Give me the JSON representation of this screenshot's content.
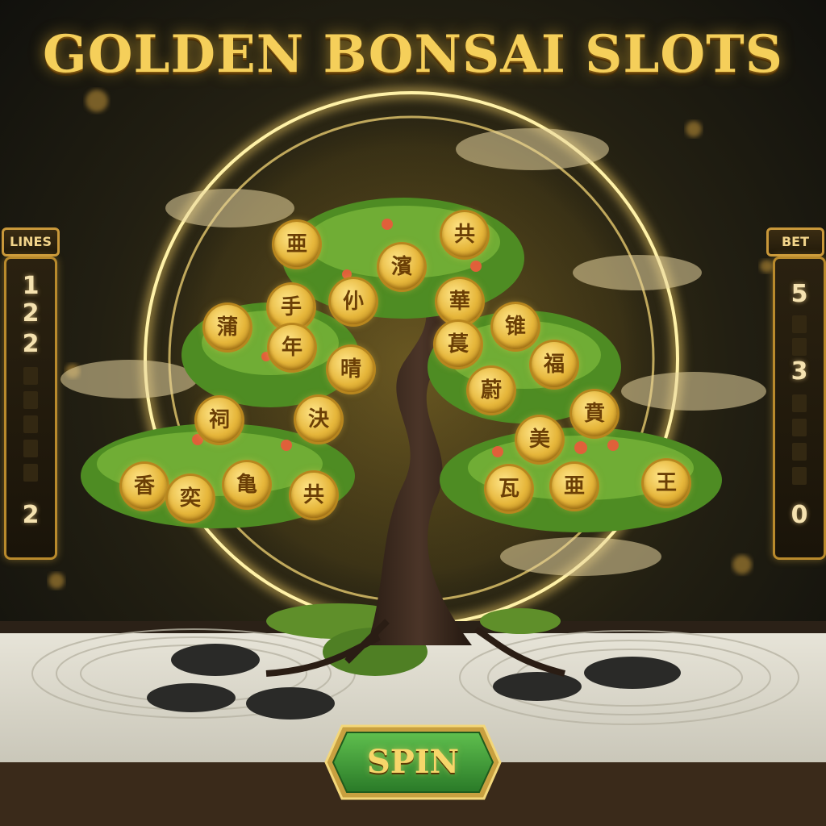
{
  "game": {
    "title": "GOLDEN BONSAI SLOTS"
  },
  "lines_panel": {
    "label": "LINES",
    "digits": [
      "1",
      "2",
      "2",
      "",
      "",
      "",
      "",
      "",
      "2"
    ]
  },
  "bet_panel": {
    "label": "BET",
    "digits": [
      "5",
      "",
      "",
      "3",
      "",
      "",
      "",
      "",
      "0"
    ]
  },
  "coins": [
    {
      "glyph": "亜"
    },
    {
      "glyph": "共"
    },
    {
      "glyph": "濱"
    },
    {
      "glyph": "手"
    },
    {
      "glyph": "仦"
    },
    {
      "glyph": "華"
    },
    {
      "glyph": "蒲"
    },
    {
      "glyph": "年"
    },
    {
      "glyph": "萇"
    },
    {
      "glyph": "锥"
    },
    {
      "glyph": "晴"
    },
    {
      "glyph": "福"
    },
    {
      "glyph": "蔚"
    },
    {
      "glyph": "祠"
    },
    {
      "glyph": "決"
    },
    {
      "glyph": "賁"
    },
    {
      "glyph": "美"
    },
    {
      "glyph": "香"
    },
    {
      "glyph": "奕"
    },
    {
      "glyph": "亀"
    },
    {
      "glyph": "共"
    },
    {
      "glyph": "瓦"
    },
    {
      "glyph": "亜"
    },
    {
      "glyph": "王"
    }
  ],
  "spin_button": {
    "label": "SPIN"
  },
  "colors": {
    "gold": "#f5cf5a",
    "spin_green": "#3f9a3a"
  }
}
